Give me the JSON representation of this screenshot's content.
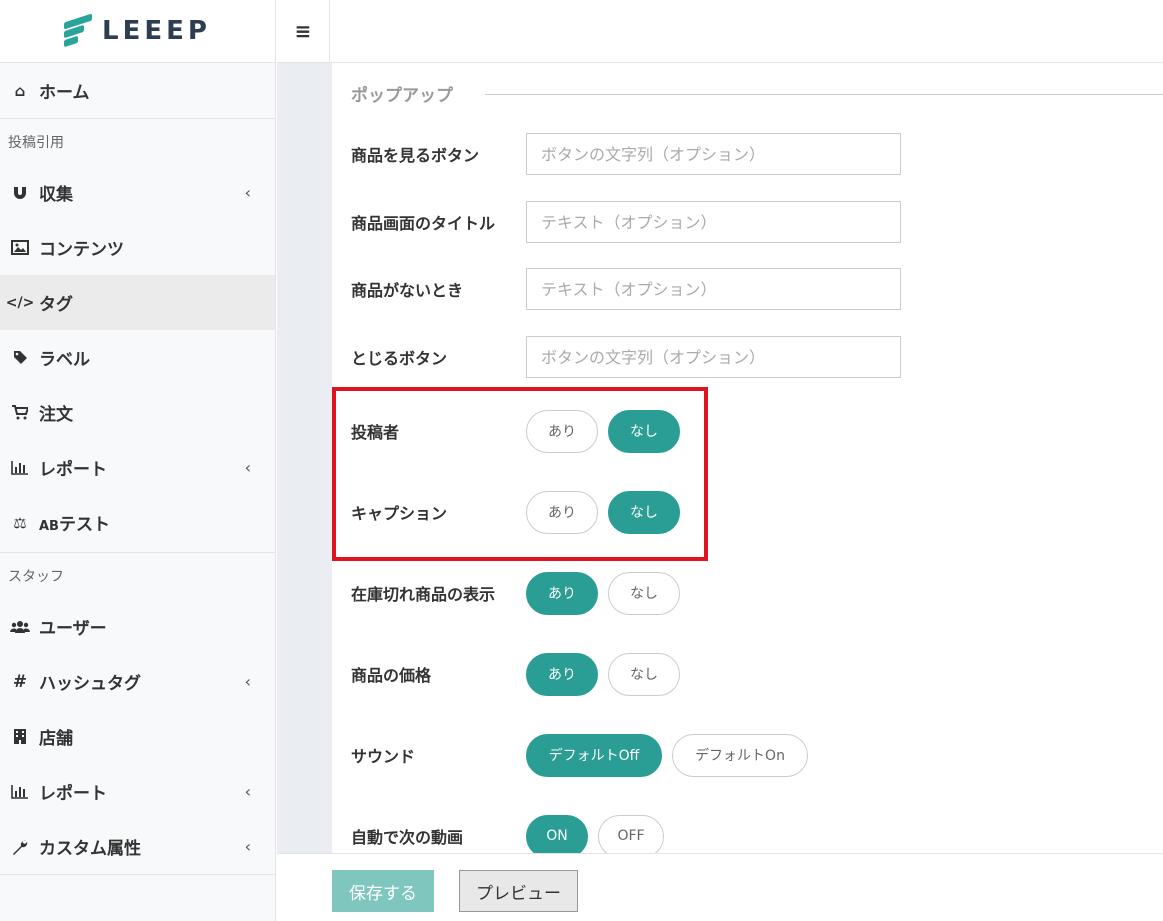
{
  "brand": {
    "name": "LEEEP",
    "accent": "#2a9d94"
  },
  "topbar": {
    "menu_icon": "≡"
  },
  "sidebar": {
    "home": {
      "label": "ホーム",
      "icon": "home-icon"
    },
    "section_post": "投稿引用",
    "post_items": [
      {
        "label": "収集",
        "icon": "magnet-icon",
        "chevron": "‹"
      },
      {
        "label": "コンテンツ",
        "icon": "image-icon"
      },
      {
        "label": "タグ",
        "icon": "code-icon"
      },
      {
        "label": "ラベル",
        "icon": "tag-icon"
      },
      {
        "label": "注文",
        "icon": "cart-icon"
      },
      {
        "label": "レポート",
        "icon": "bar-chart-icon",
        "chevron": "‹"
      },
      {
        "label": "ABテスト",
        "ab": "AB",
        "rest": "テスト",
        "icon": "scale-icon"
      }
    ],
    "section_staff": "スタッフ",
    "staff_items": [
      {
        "label": "ユーザー",
        "icon": "users-icon"
      },
      {
        "label": "ハッシュタグ",
        "icon": "hash-icon",
        "chevron": "‹"
      },
      {
        "label": "店舗",
        "icon": "building-icon"
      },
      {
        "label": "レポート",
        "icon": "bar-chart-icon",
        "chevron": "‹"
      },
      {
        "label": "カスタム属性",
        "icon": "wrench-icon",
        "chevron": "‹"
      }
    ]
  },
  "form": {
    "legend": "ポップアップ",
    "text_fields": [
      {
        "label": "商品を見るボタン",
        "placeholder": "ボタンの文字列（オプション）",
        "value": ""
      },
      {
        "label": "商品画面のタイトル",
        "placeholder": "テキスト（オプション）",
        "value": ""
      },
      {
        "label": "商品がないとき",
        "placeholder": "テキスト（オプション）",
        "value": ""
      },
      {
        "label": "とじるボタン",
        "placeholder": "ボタンの文字列（オプション）",
        "value": ""
      }
    ],
    "toggles": [
      {
        "label": "投稿者",
        "options": [
          "あり",
          "なし"
        ],
        "selected": "なし"
      },
      {
        "label": "キャプション",
        "options": [
          "あり",
          "なし"
        ],
        "selected": "なし"
      },
      {
        "label": "在庫切れ商品の表示",
        "options": [
          "あり",
          "なし"
        ],
        "selected": "あり"
      },
      {
        "label": "商品の価格",
        "options": [
          "あり",
          "なし"
        ],
        "selected": "あり"
      },
      {
        "label": "サウンド",
        "options": [
          "デフォルトOff",
          "デフォルトOn"
        ],
        "selected": "デフォルトOff"
      },
      {
        "label": "自動で次の動画",
        "options": [
          "ON",
          "OFF"
        ],
        "selected": "ON"
      }
    ]
  },
  "footer": {
    "save_label": "保存する",
    "preview_label": "プレビュー"
  },
  "highlight_color": "#e0141e"
}
